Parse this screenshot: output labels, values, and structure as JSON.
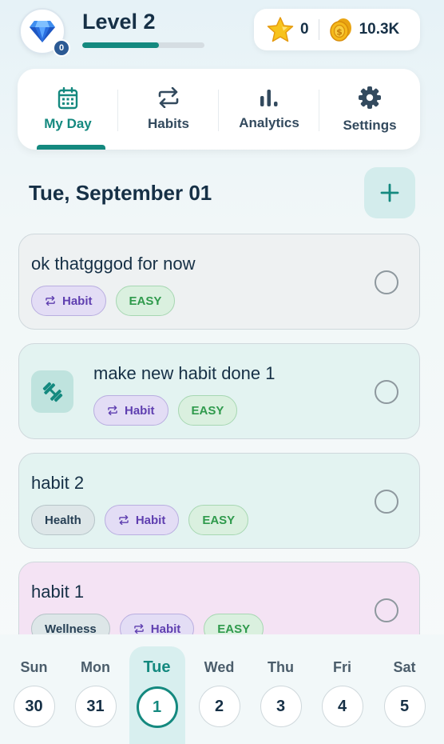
{
  "header": {
    "level_label": "Level 2",
    "avatar_badge": "0",
    "xp_progress": 0.63,
    "stars": "0",
    "coins": "10.3K"
  },
  "nav": {
    "tabs": [
      {
        "label": "My Day",
        "icon": "calendar-icon",
        "active": true
      },
      {
        "label": "Habits",
        "icon": "repeat-icon",
        "active": false
      },
      {
        "label": "Analytics",
        "icon": "bar-chart-icon",
        "active": false
      },
      {
        "label": "Settings",
        "icon": "gear-icon",
        "active": false
      }
    ]
  },
  "main": {
    "date_title": "Tue, September 01",
    "add_icon": "plus-icon",
    "tasks": [
      {
        "title": "ok thatgggod for now",
        "tags": [
          "Habit",
          "EASY"
        ],
        "color": "#eef1f2",
        "has_icon": false
      },
      {
        "title": "make new habit done 1",
        "tags": [
          "Habit",
          "EASY"
        ],
        "color": "#e3f3f1",
        "has_icon": true,
        "icon": "dumbbell-icon"
      },
      {
        "title": "habit 2",
        "category": "Health",
        "tags": [
          "Habit",
          "EASY"
        ],
        "color": "#e3f3f1",
        "has_icon": false
      },
      {
        "title": "habit 1",
        "category": "Wellness",
        "tags": [
          "Habit",
          "EASY"
        ],
        "color": "#f4e3f4",
        "has_icon": false
      }
    ]
  },
  "week": {
    "days": [
      {
        "name": "Sun",
        "num": "30"
      },
      {
        "name": "Mon",
        "num": "31"
      },
      {
        "name": "Tue",
        "num": "1",
        "active": true
      },
      {
        "name": "Wed",
        "num": "2"
      },
      {
        "name": "Thu",
        "num": "3"
      },
      {
        "name": "Fri",
        "num": "4"
      },
      {
        "name": "Sat",
        "num": "5"
      }
    ]
  },
  "colors": {
    "accent": "#14897f",
    "habit_chip": "#e3ddf5",
    "easy_chip": "#daf0df"
  }
}
